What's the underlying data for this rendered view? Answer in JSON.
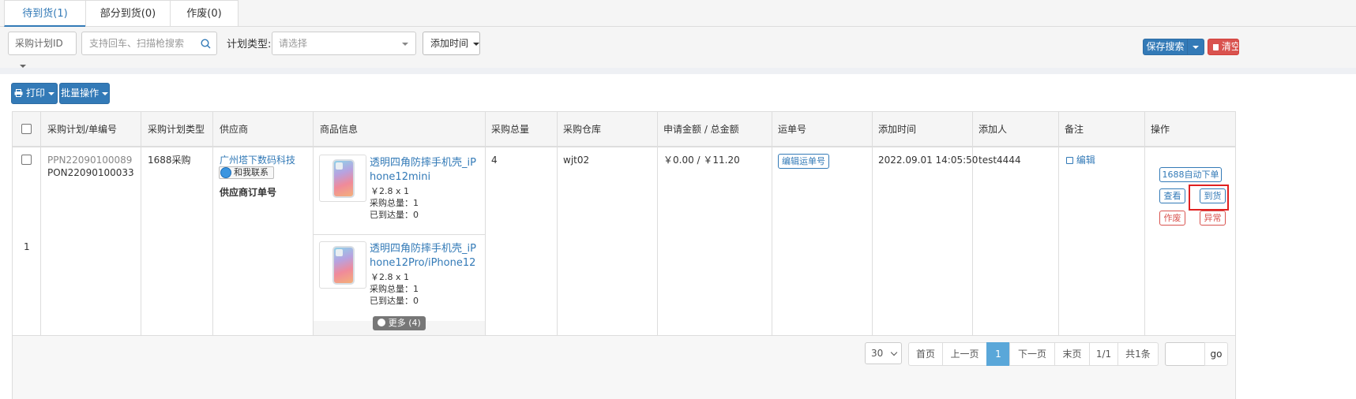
{
  "tabs": [
    {
      "label": "待到货(1)"
    },
    {
      "label": "部分到货(0)"
    },
    {
      "label": "作废(0)"
    }
  ],
  "filters": {
    "plan_id_select": "采购计划ID",
    "search_placeholder": "支持回车、扫描枪搜索",
    "plan_type_label": "计划类型:",
    "plan_type_placeholder": "请选择",
    "add_time_select": "添加时间",
    "save_search_label": "保存搜索",
    "clear_label": "清空"
  },
  "toolbar": {
    "print_label": "打印",
    "batch_label": "批量操作"
  },
  "table": {
    "headers": [
      "采购计划/单编号",
      "采购计划类型",
      "供应商",
      "商品信息",
      "采购总量",
      "采购仓库",
      "申请金额 / 总金额",
      "运单号",
      "添加时间",
      "添加人",
      "备注",
      "操作"
    ],
    "rows": [
      {
        "index": "1",
        "plan_no": "PPN22090100089",
        "order_no": "PON22090100033",
        "plan_type": "1688采购",
        "supplier_name": "广州塔下数码科技",
        "contact_label": "和我联系",
        "supplier_order_label": "供应商订单号",
        "products": [
          {
            "title_line1": "透明四角防摔手机壳_iP",
            "title_line2": "hone12mini",
            "price": "￥2.8 x 1",
            "total_qty": "采购总量：1",
            "arrived_qty": "已到达量：0"
          },
          {
            "title_line1": "透明四角防摔手机壳_iP",
            "title_line2": "hone12Pro/iPhone12",
            "price": "￥2.8 x 1",
            "total_qty": "采购总量：1",
            "arrived_qty": "已到达量：0"
          }
        ],
        "more_label": "更多 (4)",
        "quantity": "4",
        "warehouse": "wjt02",
        "amount": "￥0.00 / ￥11.20",
        "edit_waybill_label": "编辑运单号",
        "added_time": "2022.09.01 14:05:50",
        "added_by": "test4444",
        "remark_edit_label": "编辑",
        "actions": {
          "auto_order": "1688自动下单",
          "view": "查看",
          "arrive": "到货",
          "void": "作废",
          "exception": "异常"
        }
      }
    ]
  },
  "pagination": {
    "page_size": "30",
    "first": "首页",
    "prev": "上一页",
    "current": "1",
    "next": "下一页",
    "last": "末页",
    "pages": "1/1",
    "total": "共1条",
    "go": "go"
  },
  "colors": {
    "primary": "#337ab7",
    "danger": "#d9534f",
    "highlight": "#e02020"
  }
}
